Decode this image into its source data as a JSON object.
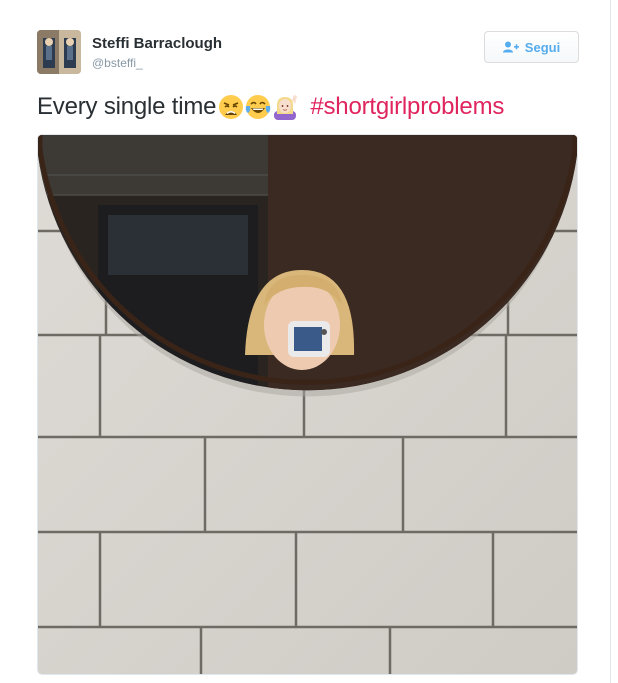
{
  "tweet": {
    "author_name": "Steffi Barraclough",
    "author_handle": "@bsteffi_",
    "follow_label": "Segui",
    "text": "Every single time",
    "emojis": [
      "weary-face",
      "face-with-tears-of-joy",
      "woman-raising-hand"
    ],
    "hashtag": "#shortgirlproblems"
  },
  "colors": {
    "hashtag": "#e0245e",
    "follow_accent": "#55acee",
    "name": "#292f33",
    "handle": "#8899a6"
  }
}
